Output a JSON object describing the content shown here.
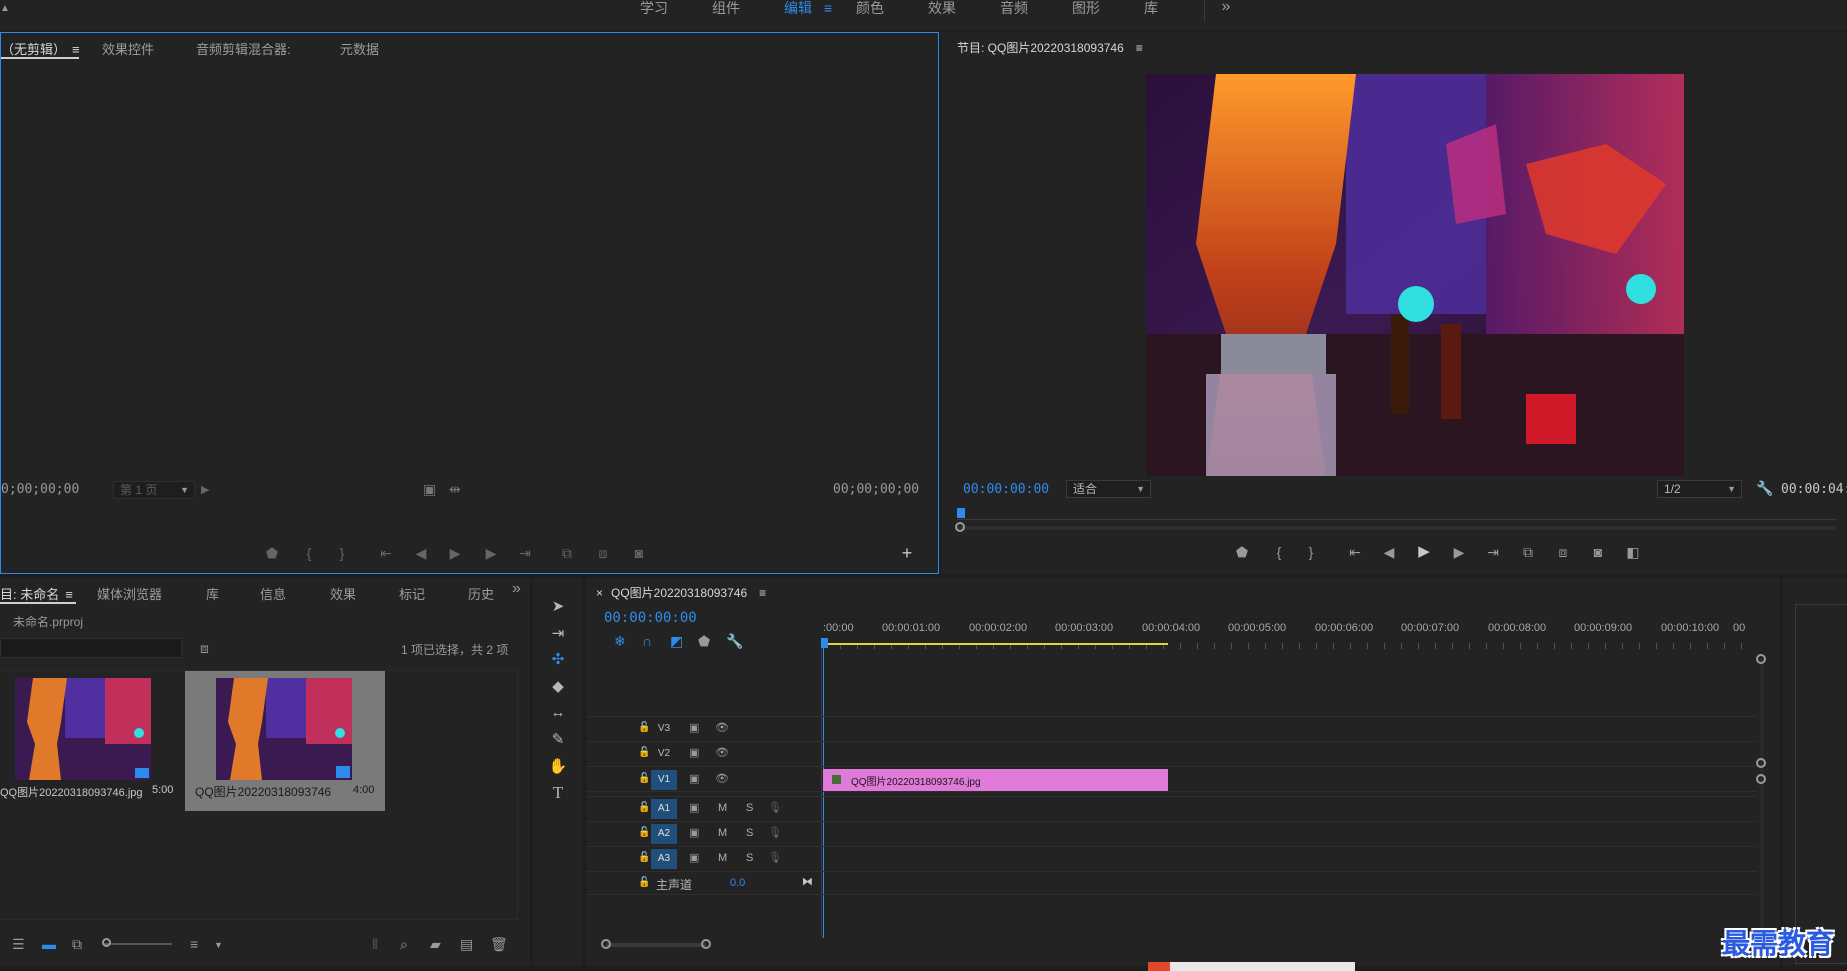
{
  "workspaces": {
    "tabs": [
      "学习",
      "组件",
      "编辑",
      "颜色",
      "效果",
      "音频",
      "图形",
      "库"
    ],
    "active": "编辑",
    "menu_icon": "hamburger-icon",
    "overflow_icon": "double-chevron-right-icon"
  },
  "source_panel": {
    "tabs": [
      "（无剪辑）",
      "效果控件",
      "音频剪辑混合器:",
      "元数据"
    ],
    "active_tab": "（无剪辑）",
    "timecode_left": "0;00;00;00",
    "page_select": "第 1 页",
    "timecode_right": "00;00;00;00"
  },
  "program_panel": {
    "title": "节目: QQ图片20220318093746",
    "timecode": "00:00:00:00",
    "fit_select": "适合",
    "quality_select": "1/2",
    "duration": "00:00:04:0"
  },
  "project_panel": {
    "tabs": [
      "目: 未命名",
      "媒体浏览器",
      "库",
      "信息",
      "效果",
      "标记",
      "历史"
    ],
    "active_tab": "目: 未命名",
    "project_file": "未命名.prproj",
    "selection_status": "1 项已选择，共 2 项",
    "items": [
      {
        "name": "QQ图片20220318093746.jpg",
        "duration": "5:00"
      },
      {
        "name": "QQ图片20220318093746",
        "duration": "4:00"
      }
    ]
  },
  "timeline": {
    "sequence_name": "QQ图片20220318093746",
    "timecode": "00:00:00:00",
    "ruler": [
      ":00:00",
      "00:00:01:00",
      "00:00:02:00",
      "00:00:03:00",
      "00:00:04:00",
      "00:00:05:00",
      "00:00:06:00",
      "00:00:07:00",
      "00:00:08:00",
      "00:00:09:00",
      "00:00:10:00",
      "00"
    ],
    "video_tracks": [
      "V3",
      "V2",
      "V1"
    ],
    "audio_tracks": [
      "A1",
      "A2",
      "A3"
    ],
    "mute_label": "M",
    "solo_label": "S",
    "master_label": "主声道",
    "master_value": "0.0",
    "clip_name": "QQ图片20220318093746.jpg"
  },
  "watermark": "最需教育",
  "colors": {
    "accent": "#2d8ceb",
    "clip": "#e07ad8",
    "track_on": "#1f4f7a"
  }
}
